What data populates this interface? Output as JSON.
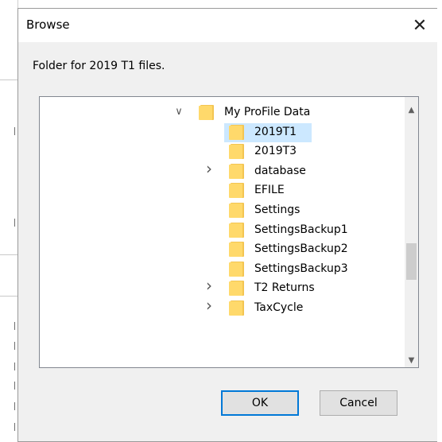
{
  "dialog": {
    "title": "Browse",
    "close_glyph": "✕",
    "prompt": "Folder for 2019 T1 files.",
    "ok_label": "OK",
    "cancel_label": "Cancel"
  },
  "tree": {
    "items": [
      {
        "label": "My ProFile Data",
        "depth": 0,
        "chevron": "expanded",
        "selected": false
      },
      {
        "label": "2019T1",
        "depth": 1,
        "chevron": "none",
        "selected": true
      },
      {
        "label": "2019T3",
        "depth": 1,
        "chevron": "none",
        "selected": false
      },
      {
        "label": "database",
        "depth": 1,
        "chevron": "collapsed",
        "selected": false
      },
      {
        "label": "EFILE",
        "depth": 1,
        "chevron": "none",
        "selected": false
      },
      {
        "label": "Settings",
        "depth": 1,
        "chevron": "none",
        "selected": false
      },
      {
        "label": "SettingsBackup1",
        "depth": 1,
        "chevron": "none",
        "selected": false
      },
      {
        "label": "SettingsBackup2",
        "depth": 1,
        "chevron": "none",
        "selected": false
      },
      {
        "label": "SettingsBackup3",
        "depth": 1,
        "chevron": "none",
        "selected": false
      },
      {
        "label": "T2 Returns",
        "depth": 1,
        "chevron": "collapsed",
        "selected": false
      },
      {
        "label": "TaxCycle",
        "depth": 1,
        "chevron": "collapsed",
        "selected": false
      }
    ]
  },
  "icons": {
    "folder": "folder-icon",
    "expanded": "chevron-down-icon",
    "collapsed": "chevron-right-icon",
    "scroll_up": "scroll-up-arrow-icon",
    "scroll_down": "scroll-down-arrow-icon"
  },
  "colors": {
    "selection": "#cce8ff",
    "folder": "#ffd96b",
    "default_button_border": "#0078d7"
  }
}
